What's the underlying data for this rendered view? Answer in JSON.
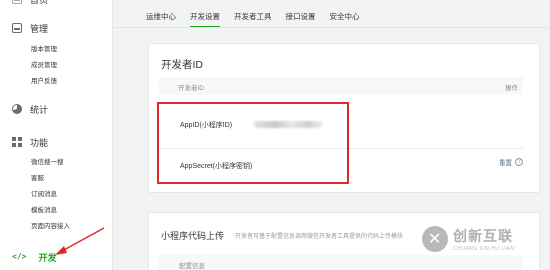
{
  "sidebar": {
    "top_cut": "首页",
    "sections": [
      {
        "title": "管理",
        "icon": "inbox-icon",
        "items": [
          "版本管理",
          "成员管理",
          "用户反馈"
        ]
      },
      {
        "title": "统计",
        "icon": "pie-chart-icon",
        "items": []
      },
      {
        "title": "功能",
        "icon": "grid-icon",
        "items": [
          "微信搜一搜",
          "客服",
          "订阅消息",
          "模板消息",
          "页面内容接入"
        ]
      }
    ],
    "dev": {
      "title": "开发",
      "icon": "code-icon"
    }
  },
  "tabs": [
    "运维中心",
    "开发设置",
    "开发者工具",
    "接口设置",
    "安全中心"
  ],
  "active_tab": 1,
  "developer_id": {
    "title": "开发者ID",
    "col_id": "开发者ID",
    "col_action": "操作",
    "appid_label": "AppID(小程序ID)",
    "appsecret_label": "AppSecret(小程序密钥)",
    "reset_label": "重置",
    "help_icon": "?"
  },
  "upload": {
    "title": "小程序代码上传",
    "desc": "开发者可基于配置信息调用微信开发者工具提供的代码上传模块",
    "col_config": "配置信息"
  },
  "watermark": {
    "main": "创新互联",
    "sub": "CHUANG XIN HU LIAN"
  },
  "colors": {
    "accent": "#1aad19",
    "highlight": "#e0282b",
    "link": "#576b95"
  }
}
